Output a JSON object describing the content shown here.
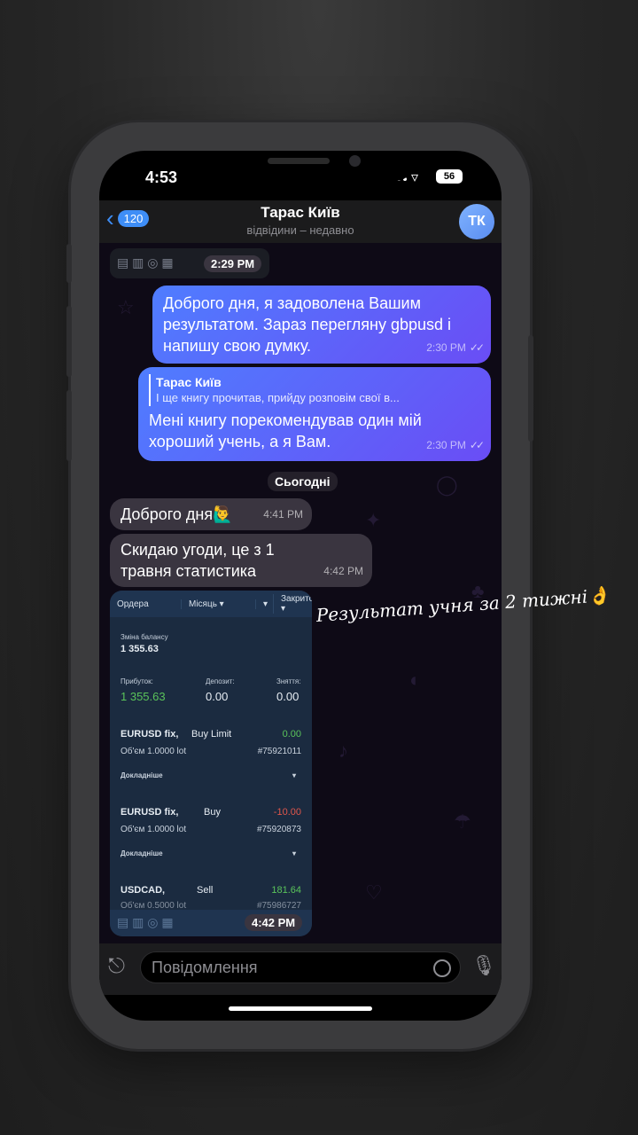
{
  "status": {
    "time": "4:53",
    "battery": "56"
  },
  "header": {
    "back_count": "120",
    "title": "Тарас Київ",
    "subtitle": "відвідини – недавно",
    "avatar_initials": "ТК"
  },
  "top_pill_time": "2:29 PM",
  "messages": [
    {
      "text": "Доброго дня, я задоволена Вашим результатом. Зараз перегляну gbpusd і напишу свою думку.",
      "time": "2:30 PM"
    },
    {
      "reply_name": "Тарас Київ",
      "reply_text": "І ще книгу прочитав, прийду розповім свої в...",
      "text": "Мені книгу порекомендував один мій хороший учень, а я Вам.",
      "time": "2:30 PM"
    },
    {
      "text": "Доброго дня🙋‍♂️",
      "time": "4:41 PM"
    },
    {
      "text": "Скидаю угоди, це з 1 травня статистика",
      "time": "4:42 PM"
    }
  ],
  "date_separator": "Сьогодні",
  "screenshot": {
    "tab_orders": "Ордера",
    "tab_month": "Місяць ▾",
    "tab_closed": "Закрито ▾",
    "balance_change_label": "Зміна балансу",
    "balance_change": "1 355.63",
    "profit_label": "Прибуток:",
    "profit": "1 355.63",
    "deposit_label": "Депозит:",
    "deposit": "0.00",
    "withdraw_label": "Зняття:",
    "withdraw": "0.00",
    "details_label": "Докладніше",
    "trades": [
      {
        "symbol": "EURUSD fix,",
        "type": "Buy Limit",
        "value": "0.00",
        "volume": "Об'єм 1.0000 lot",
        "id": "#75921011"
      },
      {
        "symbol": "EURUSD fix,",
        "type": "Buy",
        "value": "-10.00",
        "volume": "Об'єм 1.0000 lot",
        "id": "#75920873"
      },
      {
        "symbol": "USDCAD,",
        "type": "Sell",
        "value": "181.64",
        "volume": "Об'єм 0.5000 lot",
        "id": "#75986727"
      }
    ],
    "time": "4:42 PM"
  },
  "input": {
    "placeholder": "Повідомлення"
  },
  "overlay_caption": "Результат учня за 2 тижні👌"
}
